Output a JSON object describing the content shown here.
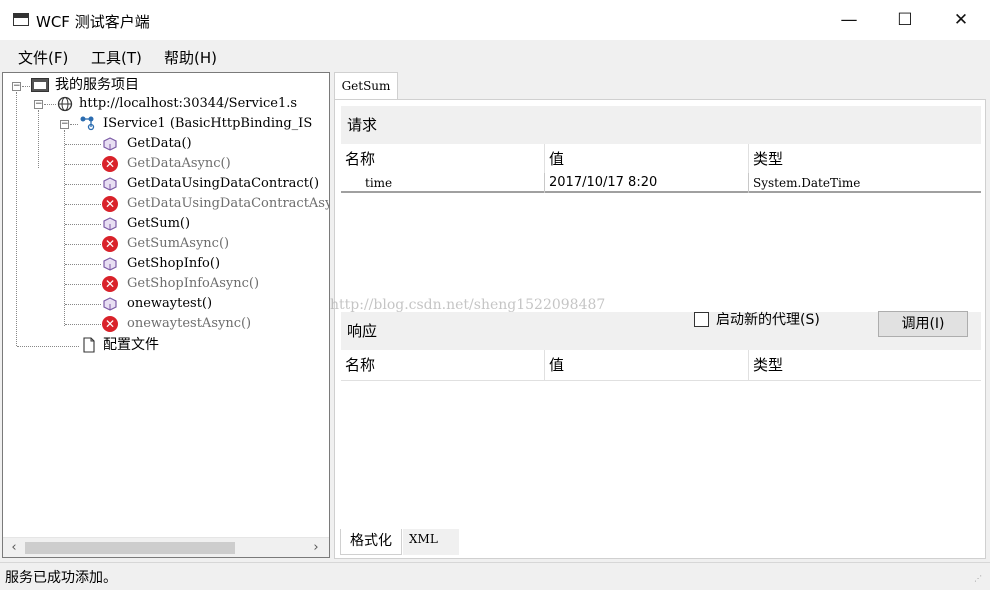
{
  "titlebar": {
    "title": "WCF 测试客户端",
    "minimize": "—",
    "maximize": "☐",
    "close": "✕"
  },
  "menu": {
    "file": "文件(F)",
    "tools": "工具(T)",
    "help": "帮助(H)"
  },
  "tree": {
    "root": "我的服务项目",
    "endpoint": "http://localhost:30344/Service1.s",
    "contract": "IService1 (BasicHttpBinding_IS",
    "operations": [
      {
        "label": "GetData()",
        "state": "ok"
      },
      {
        "label": "GetDataAsync()",
        "state": "error"
      },
      {
        "label": "GetDataUsingDataContract()",
        "state": "ok"
      },
      {
        "label": "GetDataUsingDataContractAsy",
        "state": "error"
      },
      {
        "label": "GetSum()",
        "state": "ok"
      },
      {
        "label": "GetSumAsync()",
        "state": "error"
      },
      {
        "label": "GetShopInfo()",
        "state": "ok"
      },
      {
        "label": "GetShopInfoAsync()",
        "state": "error"
      },
      {
        "label": "onewaytest()",
        "state": "ok"
      },
      {
        "label": "onewaytestAsync()",
        "state": "error"
      }
    ],
    "config": "配置文件"
  },
  "tab": {
    "label": "GetSum"
  },
  "request": {
    "title": "请求",
    "headers": {
      "name": "名称",
      "value": "值",
      "type": "类型"
    },
    "rows": [
      {
        "name": "time",
        "value": "2017/10/17 8:20",
        "type": "System.DateTime"
      }
    ]
  },
  "response": {
    "title": "响应",
    "headers": {
      "name": "名称",
      "value": "值",
      "type": "类型"
    }
  },
  "new_proxy_label": "启动新的代理(S)",
  "invoke_button": "调用(I)",
  "watermark": "http://blog.csdn.net/sheng1522098487",
  "bottom_tabs": {
    "formatted": "格式化",
    "xml": "XML"
  },
  "status": "服务已成功添加。",
  "colors": {
    "error": "#d9222a",
    "operation_icon": "#7b5aa6",
    "endpoint_icon": "#2b6cb0"
  }
}
